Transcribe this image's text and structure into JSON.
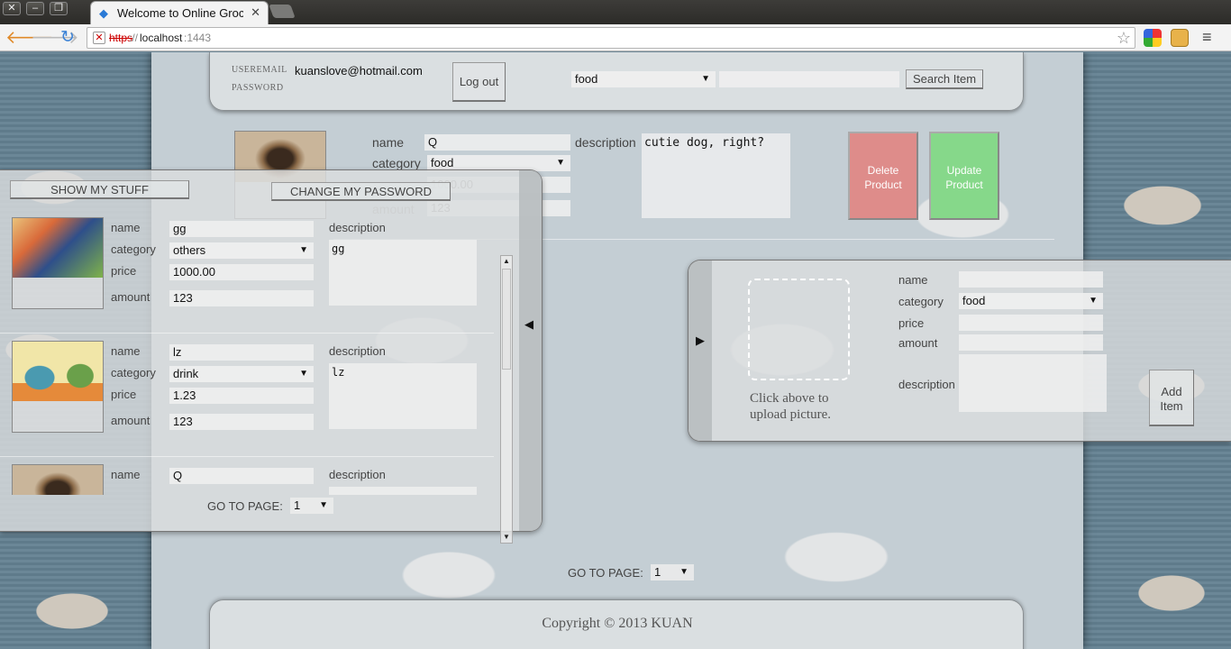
{
  "browser": {
    "tab_title": "Welcome to Online Groce",
    "url_scheme": "https",
    "url_separator": "://",
    "url_host": "localhost",
    "url_port": ":1443"
  },
  "header": {
    "useremail_label": "USEREMAIL",
    "password_label": "PASSWORD",
    "useremail_value": "kuanslove@hotmail.com",
    "logout_label": "Log out",
    "search_category": "food",
    "search_input": "",
    "search_button": "Search Item"
  },
  "product_editor": {
    "name_label": "name",
    "name_value": "Q",
    "category_label": "category",
    "category_value": "food",
    "price_value": "1000.00",
    "amount_label": "amount",
    "amount_value": "123",
    "description_label": "description",
    "description_value": "cutie dog, right?",
    "delete_button": "Delete Product",
    "update_button": "Update Product"
  },
  "my_stuff": {
    "show_my_stuff": "SHOW MY STUFF",
    "change_password": "CHANGE MY PASSWORD",
    "toggle_arrow": "◀",
    "labels": {
      "name": "name",
      "category": "category",
      "price": "price",
      "amount": "amount",
      "description": "description"
    },
    "items": [
      {
        "name": "gg",
        "category": "others",
        "price": "1000.00",
        "amount": "123",
        "description": "gg"
      },
      {
        "name": "lz",
        "category": "drink",
        "price": "1.23",
        "amount": "123",
        "description": "lz"
      },
      {
        "name": "Q",
        "category": "",
        "price": "",
        "amount": "",
        "description": ""
      }
    ],
    "goto_label": "GO TO PAGE:",
    "goto_value": "1"
  },
  "add_item": {
    "toggle_arrow": "▶",
    "upload_text": "Click above to upload picture.",
    "name_label": "name",
    "category_label": "category",
    "category_value": "food",
    "price_label": "price",
    "amount_label": "amount",
    "description_label": "description",
    "add_button": "Add Item"
  },
  "pagination": {
    "goto_label": "GO TO PAGE:",
    "goto_value": "1"
  },
  "footer": {
    "copyright": "Copyright © 2013 KUAN"
  },
  "colors": {
    "delete": "#de8c8a",
    "update": "#86d88a",
    "frame": "#6b8797"
  }
}
